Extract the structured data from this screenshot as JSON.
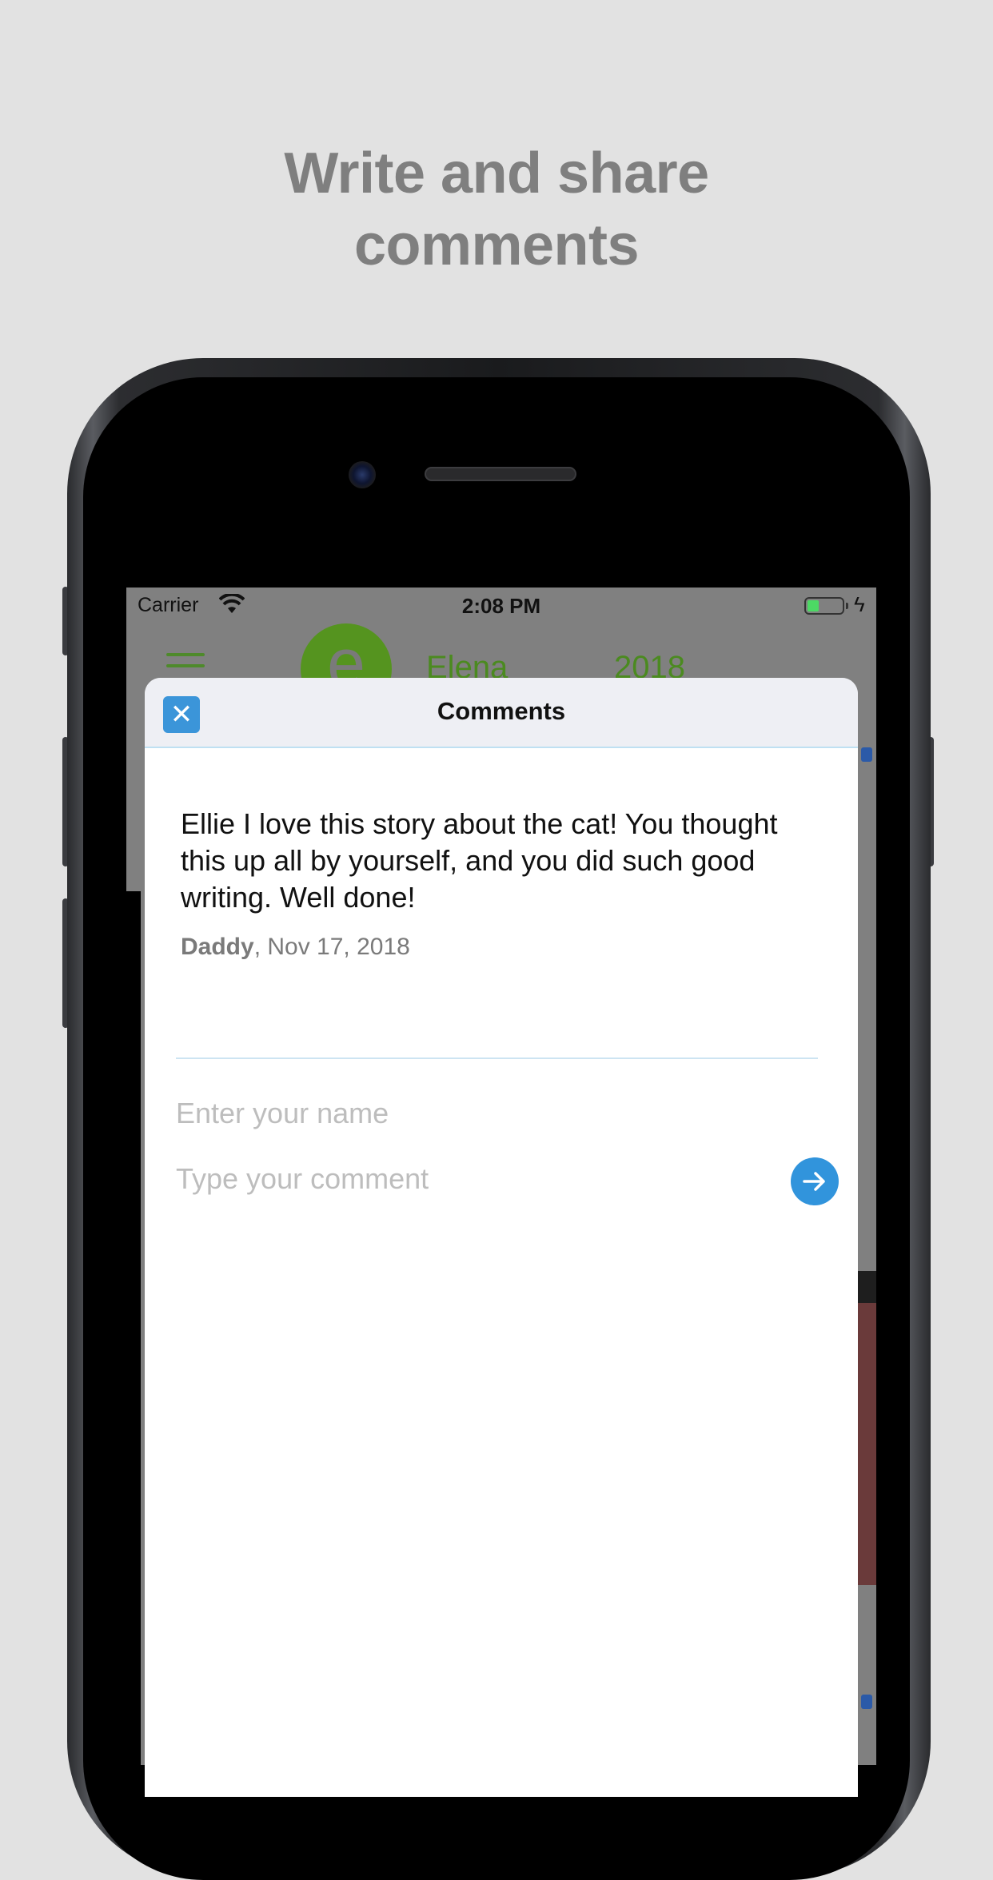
{
  "headline": {
    "line1": "Write and share",
    "line2": "comments"
  },
  "status_bar": {
    "carrier": "Carrier",
    "time": "2:08 PM"
  },
  "background_app": {
    "logo_letter": "e",
    "name": "Elena",
    "year": "2018"
  },
  "comments_sheet": {
    "title": "Comments",
    "close_icon": "close-icon",
    "comment": {
      "text": "Ellie I love this story about the cat! You thought this up all by yourself, and you did such good writing. Well done!",
      "author": "Daddy",
      "date": ", Nov 17, 2018"
    },
    "name_placeholder": "Enter your name",
    "comment_placeholder": "Type your comment",
    "send_icon": "arrow-right-icon"
  },
  "colors": {
    "page_background": "#e2e2e2",
    "accent_blue": "#3194dc",
    "brand_green": "#55941f"
  }
}
